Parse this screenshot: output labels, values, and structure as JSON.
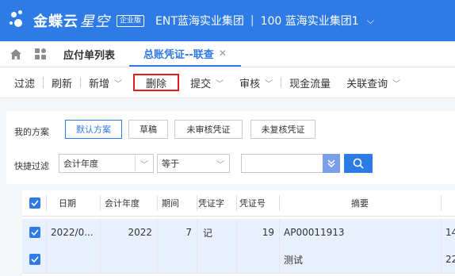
{
  "header": {
    "brand": "金蝶云",
    "brand_sub": "星空",
    "edition_badge": "企业版",
    "org_name": "ENT蓝海实业集团",
    "org_unit": "100 蓝海实业集团1"
  },
  "tabs": [
    {
      "label": "应付单列表",
      "active": false
    },
    {
      "label": "总账凭证--联查",
      "active": true
    }
  ],
  "toolbar": {
    "filter": "过滤",
    "refresh": "刷新",
    "add": "新增",
    "delete": "删除",
    "submit": "提交",
    "audit": "审核",
    "cash_flow": "现金流量",
    "related_query": "关联查询"
  },
  "filter": {
    "scheme_label": "我的方案",
    "schemes": [
      "默认方案",
      "草稿",
      "未审核凭证",
      "未复核凭证"
    ],
    "quick_label": "快捷过滤",
    "field_value": "会计年度",
    "operator_value": "等于",
    "search_value": ""
  },
  "table": {
    "columns": [
      "日期",
      "会计年度",
      "期间",
      "凭证字",
      "凭证号",
      "摘要"
    ],
    "rows": [
      {
        "date": "2022/0...",
        "year": "2022",
        "period": "7",
        "word": "记",
        "number": "19",
        "summary": "AP00011913",
        "extra": "14"
      },
      {
        "date": "",
        "year": "",
        "period": "",
        "word": "",
        "number": "",
        "summary": "测试",
        "extra": "22"
      }
    ]
  },
  "colors": {
    "accent": "#2f7be6",
    "highlight_border": "#e02020"
  }
}
